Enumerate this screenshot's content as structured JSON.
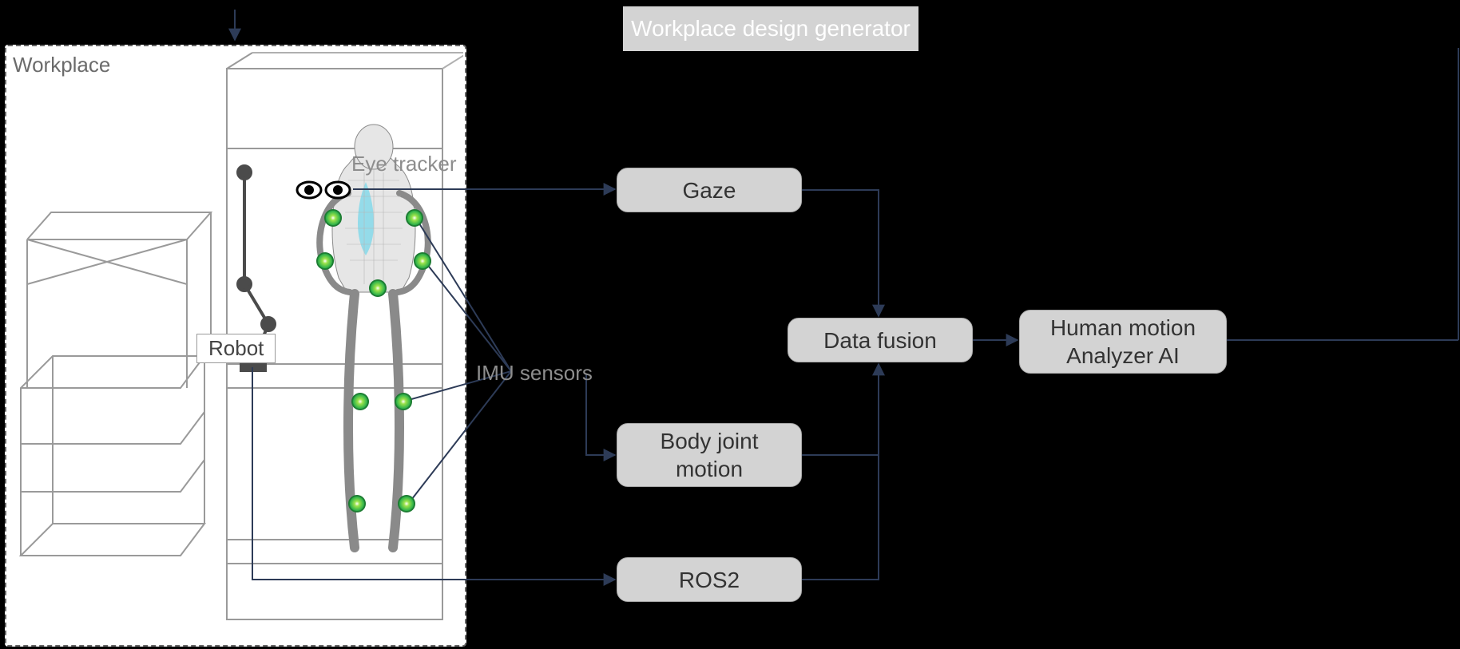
{
  "workplace_label": "Workplace",
  "robot_label": "Robot",
  "eye_tracker_label": "Eye tracker",
  "imu_label": "IMU sensors",
  "banner": "Workplace design generator",
  "nodes": {
    "gaze": "Gaze",
    "body_joint": "Body joint\nmotion",
    "ros2": "ROS2",
    "data_fusion": "Data fusion",
    "hma": "Human motion\nAnalyzer AI"
  },
  "edges_description": [
    "Eye tracker → Gaze",
    "IMU sensors → Body joint motion",
    "Robot → ROS2",
    "Gaze → Data fusion",
    "Body joint motion → Data fusion",
    "ROS2 → Data fusion",
    "Data fusion → Human motion Analyzer AI",
    "Workplace design generator ↓ Workplace (feedback)",
    "Human motion Analyzer AI → (off-diagram right)"
  ]
}
